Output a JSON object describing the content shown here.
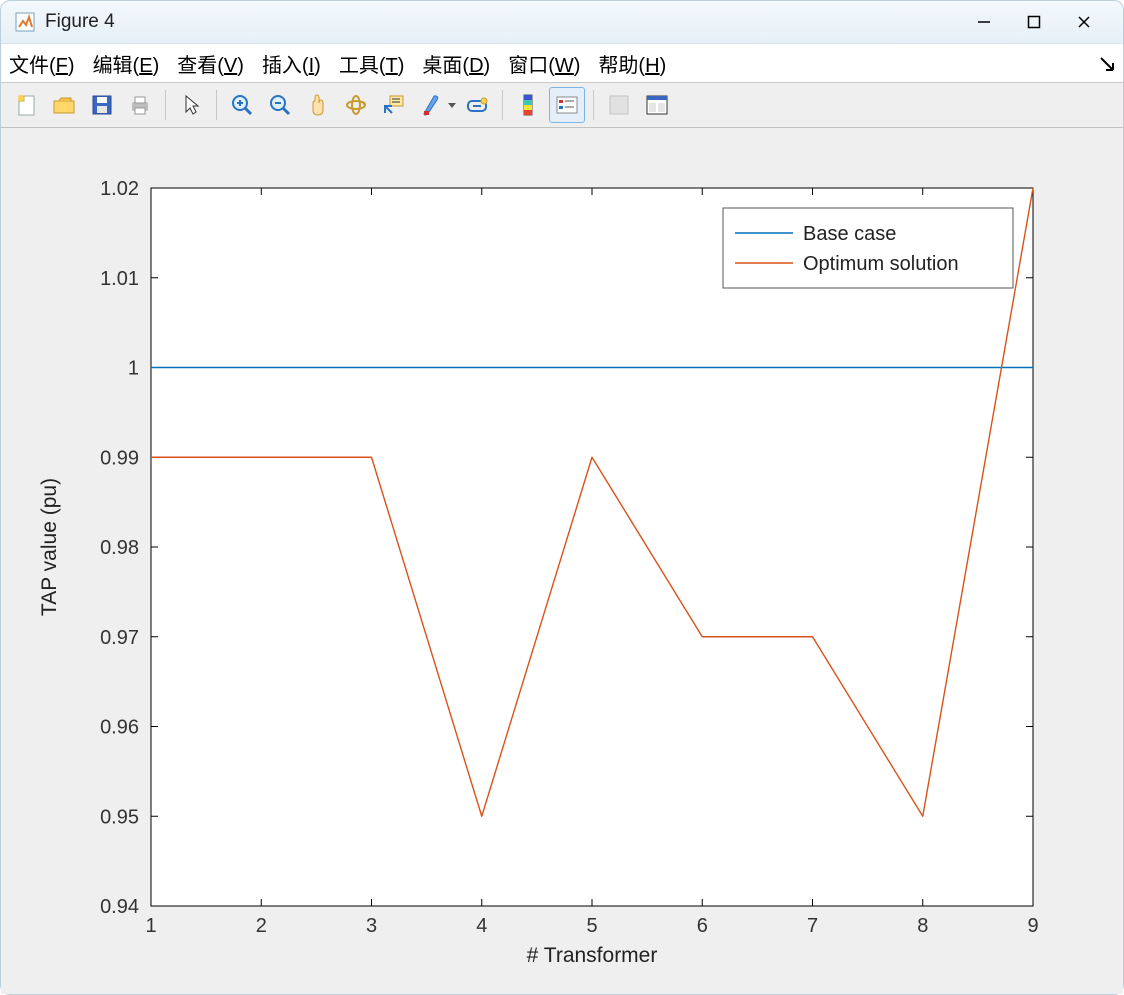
{
  "titlebar": {
    "title": "Figure 4"
  },
  "menu": {
    "file": {
      "pre": "文件(",
      "u": "F",
      "post": ")"
    },
    "edit": {
      "pre": "编辑(",
      "u": "E",
      "post": ")"
    },
    "view": {
      "pre": "查看(",
      "u": "V",
      "post": ")"
    },
    "insert": {
      "pre": "插入(",
      "u": "I",
      "post": ")"
    },
    "tools": {
      "pre": "工具(",
      "u": "T",
      "post": ")"
    },
    "desktop": {
      "pre": "桌面(",
      "u": "D",
      "post": ")"
    },
    "window": {
      "pre": "窗口(",
      "u": "W",
      "post": ")"
    },
    "help": {
      "pre": "帮助(",
      "u": "H",
      "post": ")"
    }
  },
  "chart_data": {
    "type": "line",
    "xlabel": "# Transformer",
    "ylabel": "TAP value (pu)",
    "xticks": [
      1,
      2,
      3,
      4,
      5,
      6,
      7,
      8,
      9
    ],
    "yticks": [
      0.94,
      0.95,
      0.96,
      0.97,
      0.98,
      0.99,
      1,
      1.01,
      1.02
    ],
    "xlim": [
      1,
      9
    ],
    "ylim": [
      0.94,
      1.02
    ],
    "legend_pos": "upper right",
    "series": [
      {
        "name": "Base case",
        "color": "#0072bd",
        "x": [
          1,
          2,
          3,
          4,
          5,
          6,
          7,
          8,
          9
        ],
        "y": [
          1,
          1,
          1,
          1,
          1,
          1,
          1,
          1,
          1
        ]
      },
      {
        "name": "Optimum solution",
        "color": "#d95319",
        "x": [
          1,
          2,
          3,
          4,
          5,
          6,
          7,
          8,
          9
        ],
        "y": [
          0.99,
          0.99,
          0.99,
          0.95,
          0.99,
          0.97,
          0.97,
          0.95,
          1.02
        ]
      }
    ]
  }
}
